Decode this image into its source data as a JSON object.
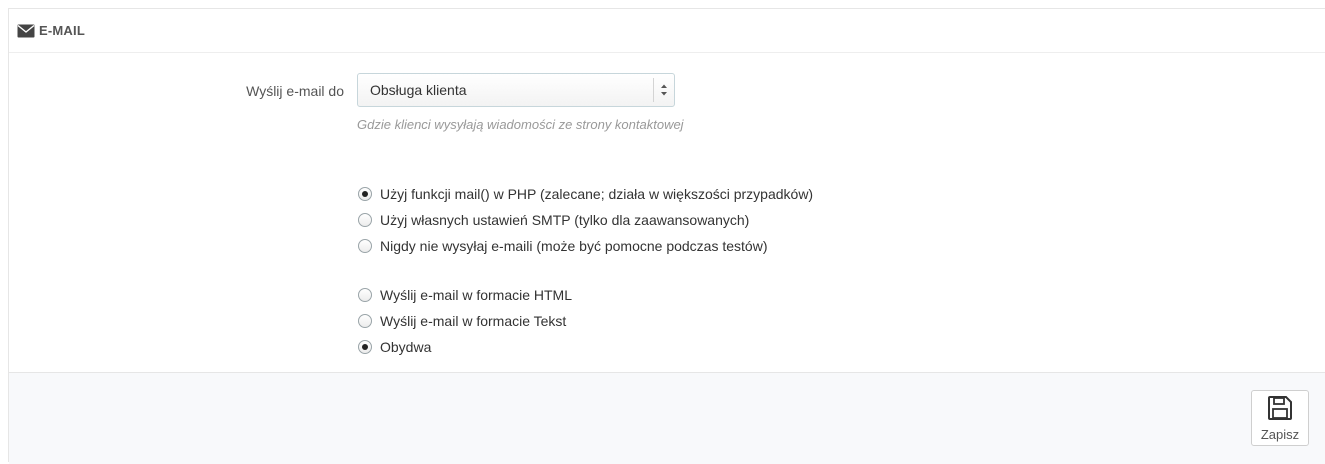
{
  "panel": {
    "title": "E-MAIL",
    "title_icon": "envelope-icon"
  },
  "send_to": {
    "label": "Wyślij e-mail do",
    "selected": "Obsługa klienta",
    "help": "Gdzie klienci wysyłają wiadomości ze strony kontaktowej"
  },
  "mail_method": {
    "options": [
      {
        "label": "Użyj funkcji mail() w PHP (zalecane; działa w większości przypadków)",
        "checked": true
      },
      {
        "label": "Użyj własnych ustawień SMTP (tylko dla zaawansowanych)",
        "checked": false
      },
      {
        "label": "Nigdy nie wysyłaj e-maili (może być pomocne podczas testów)",
        "checked": false
      }
    ]
  },
  "mail_format": {
    "options": [
      {
        "label": "Wyślij e-mail w formacie HTML",
        "checked": false
      },
      {
        "label": "Wyślij e-mail w formacie Tekst",
        "checked": false
      },
      {
        "label": "Obydwa",
        "checked": true
      }
    ]
  },
  "footer": {
    "save_label": "Zapisz",
    "save_icon": "floppy-disk-icon"
  }
}
